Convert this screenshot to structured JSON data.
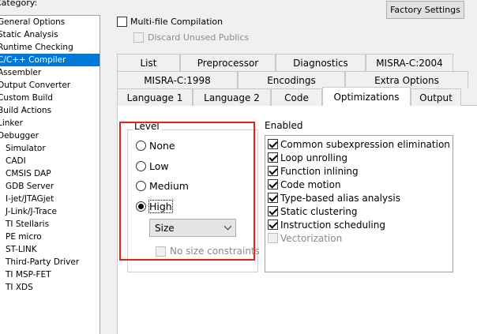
{
  "category": {
    "label": "Category:",
    "items": [
      {
        "label": "General Options",
        "level": 0
      },
      {
        "label": "Static Analysis",
        "level": 0
      },
      {
        "label": "Runtime Checking",
        "level": 0
      },
      {
        "label": "C/C++ Compiler",
        "level": 0,
        "selected": true
      },
      {
        "label": "Assembler",
        "level": 0
      },
      {
        "label": "Output Converter",
        "level": 0
      },
      {
        "label": "Custom Build",
        "level": 0
      },
      {
        "label": "Build Actions",
        "level": 0
      },
      {
        "label": "Linker",
        "level": 0
      },
      {
        "label": "Debugger",
        "level": 0
      },
      {
        "label": "Simulator",
        "level": 1
      },
      {
        "label": "CADI",
        "level": 1
      },
      {
        "label": "CMSIS DAP",
        "level": 1
      },
      {
        "label": "GDB Server",
        "level": 1
      },
      {
        "label": "I-jet/JTAGjet",
        "level": 1
      },
      {
        "label": "J-Link/J-Trace",
        "level": 1
      },
      {
        "label": "TI Stellaris",
        "level": 1
      },
      {
        "label": "PE micro",
        "level": 1
      },
      {
        "label": "ST-LINK",
        "level": 1
      },
      {
        "label": "Third-Party Driver",
        "level": 1
      },
      {
        "label": "TI MSP-FET",
        "level": 1
      },
      {
        "label": "TI XDS",
        "level": 1
      }
    ]
  },
  "factory_settings_label": "Factory Settings",
  "multi_file_label": "Multi-file Compilation",
  "discard_label": "Discard Unused Publics",
  "tabs": {
    "row1": [
      "List",
      "Preprocessor",
      "Diagnostics",
      "MISRA-C:2004"
    ],
    "row2": [
      "MISRA-C:1998",
      "Encodings",
      "Extra Options"
    ],
    "row3": [
      "Language 1",
      "Language 2",
      "Code",
      "Optimizations",
      "Output"
    ],
    "active": "Optimizations"
  },
  "level": {
    "title": "Level",
    "options": [
      "None",
      "Low",
      "Medium",
      "High"
    ],
    "selected": "High",
    "size_select": "Size",
    "no_size_label": "No size constraints"
  },
  "enabled": {
    "title": "Enabled",
    "items": [
      {
        "label": "Common subexpression elimination",
        "checked": true,
        "disabled": false
      },
      {
        "label": "Loop unrolling",
        "checked": true,
        "disabled": false
      },
      {
        "label": "Function inlining",
        "checked": true,
        "disabled": false
      },
      {
        "label": "Code motion",
        "checked": true,
        "disabled": false
      },
      {
        "label": "Type-based alias analysis",
        "checked": true,
        "disabled": false
      },
      {
        "label": "Static clustering",
        "checked": true,
        "disabled": false
      },
      {
        "label": "Instruction scheduling",
        "checked": true,
        "disabled": false
      },
      {
        "label": "Vectorization",
        "checked": false,
        "disabled": true
      }
    ]
  },
  "colors": {
    "selection": "#0078d7",
    "highlight_box": "#e2231a"
  }
}
